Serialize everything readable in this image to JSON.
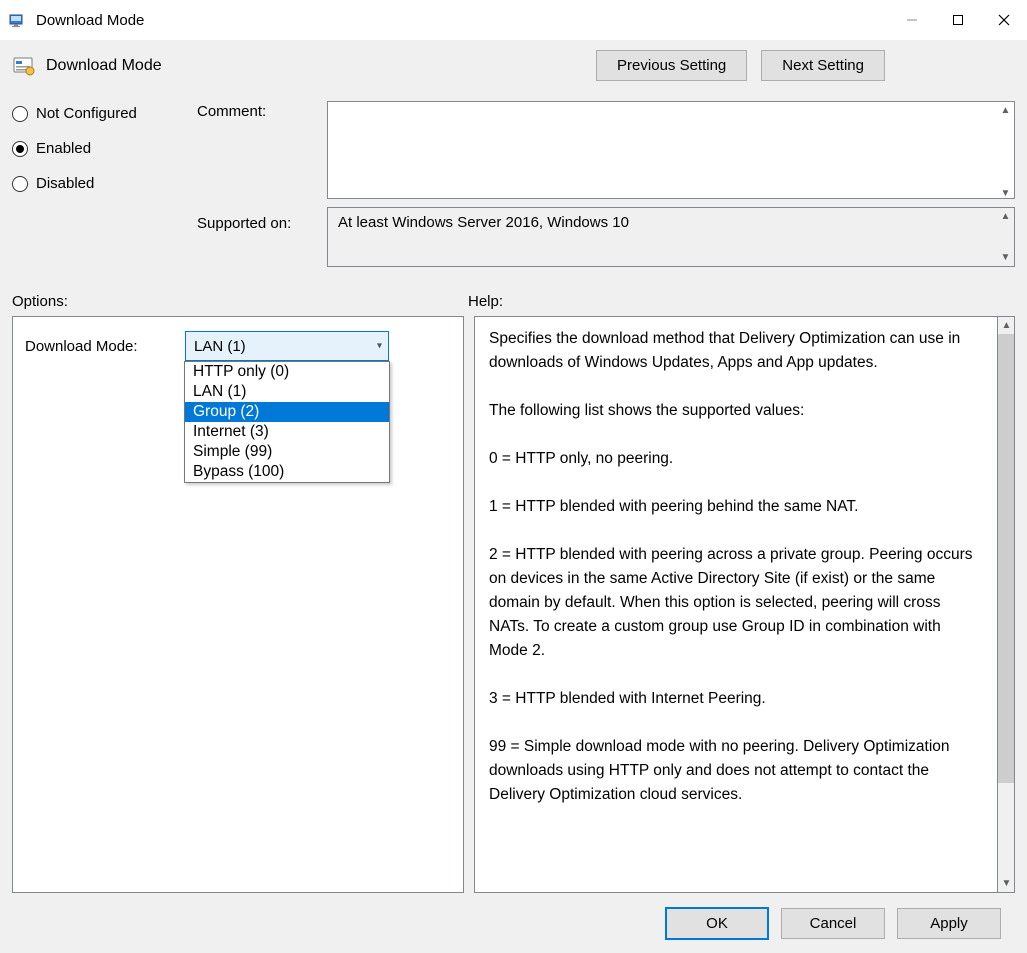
{
  "window": {
    "title": "Download Mode"
  },
  "header": {
    "policy_title": "Download Mode",
    "previous_btn": "Previous Setting",
    "next_btn": "Next Setting"
  },
  "state": {
    "radios": {
      "not_configured": "Not Configured",
      "enabled": "Enabled",
      "disabled": "Disabled",
      "selected": "enabled"
    },
    "comment_label": "Comment:",
    "comment_value": "",
    "supported_label": "Supported on:",
    "supported_value": "At least Windows Server 2016, Windows 10"
  },
  "sections": {
    "options": "Options:",
    "help": "Help:"
  },
  "options": {
    "download_mode_label": "Download Mode:",
    "selected_display": "LAN (1)",
    "items": [
      "HTTP only (0)",
      "LAN (1)",
      "Group (2)",
      "Internet (3)",
      "Simple (99)",
      "Bypass (100)"
    ],
    "highlighted_index": 2
  },
  "help": {
    "p1": "Specifies the download method that Delivery Optimization can use in downloads of Windows Updates, Apps and App updates.",
    "p2": "The following list shows the supported values:",
    "p3": "0 = HTTP only, no peering.",
    "p4": "1 = HTTP blended with peering behind the same NAT.",
    "p5": "2 = HTTP blended with peering across a private group. Peering occurs on devices in the same Active Directory Site (if exist) or the same domain by default. When this option is selected, peering will cross NATs. To create a custom group use Group ID in combination with Mode 2.",
    "p6": "3 = HTTP blended with Internet Peering.",
    "p7": "99 = Simple download mode with no peering. Delivery Optimization downloads using HTTP only and does not attempt to contact the Delivery Optimization cloud services."
  },
  "footer": {
    "ok": "OK",
    "cancel": "Cancel",
    "apply": "Apply"
  }
}
